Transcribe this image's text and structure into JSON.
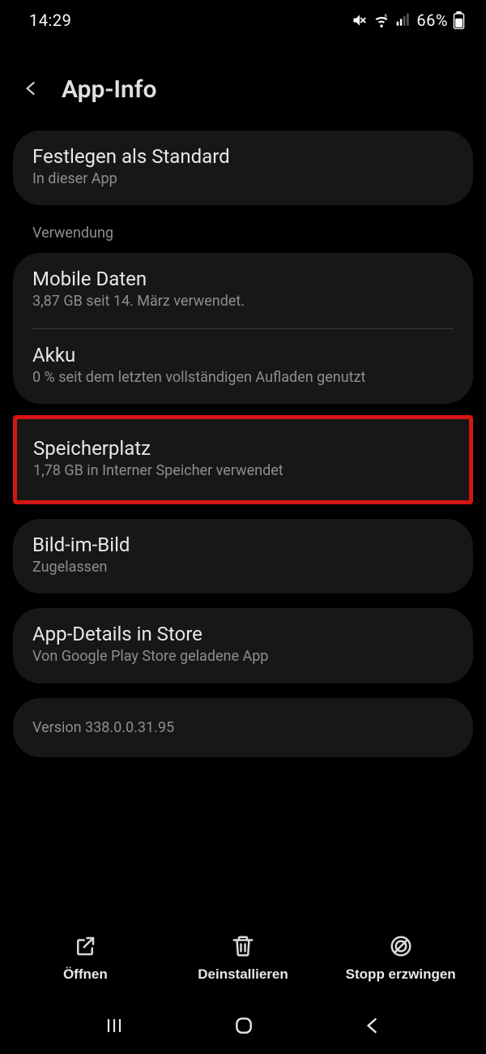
{
  "status": {
    "time": "14:29",
    "battery_pct": "66%"
  },
  "header": {
    "title": "App-Info"
  },
  "defaults_card": {
    "title": "Festlegen als Standard",
    "subtitle": "In dieser App"
  },
  "section_usage_label": "Verwendung",
  "usage_card": {
    "mobile_data": {
      "title": "Mobile Daten",
      "subtitle": "3,87 GB seit 14. März verwendet."
    },
    "battery": {
      "title": "Akku",
      "subtitle": "0 % seit dem letzten vollständigen Aufladen genutzt"
    }
  },
  "storage_card": {
    "title": "Speicherplatz",
    "subtitle": "1,78 GB in Interner Speicher verwendet"
  },
  "pip_card": {
    "title": "Bild-im-Bild",
    "subtitle": "Zugelassen"
  },
  "store_card": {
    "title": "App-Details in Store",
    "subtitle": "Von Google Play Store geladene App"
  },
  "version_card": {
    "text": "Version 338.0.0.31.95"
  },
  "actions": {
    "open": "Öffnen",
    "uninstall": "Deinstallieren",
    "force_stop": "Stopp erzwingen"
  }
}
